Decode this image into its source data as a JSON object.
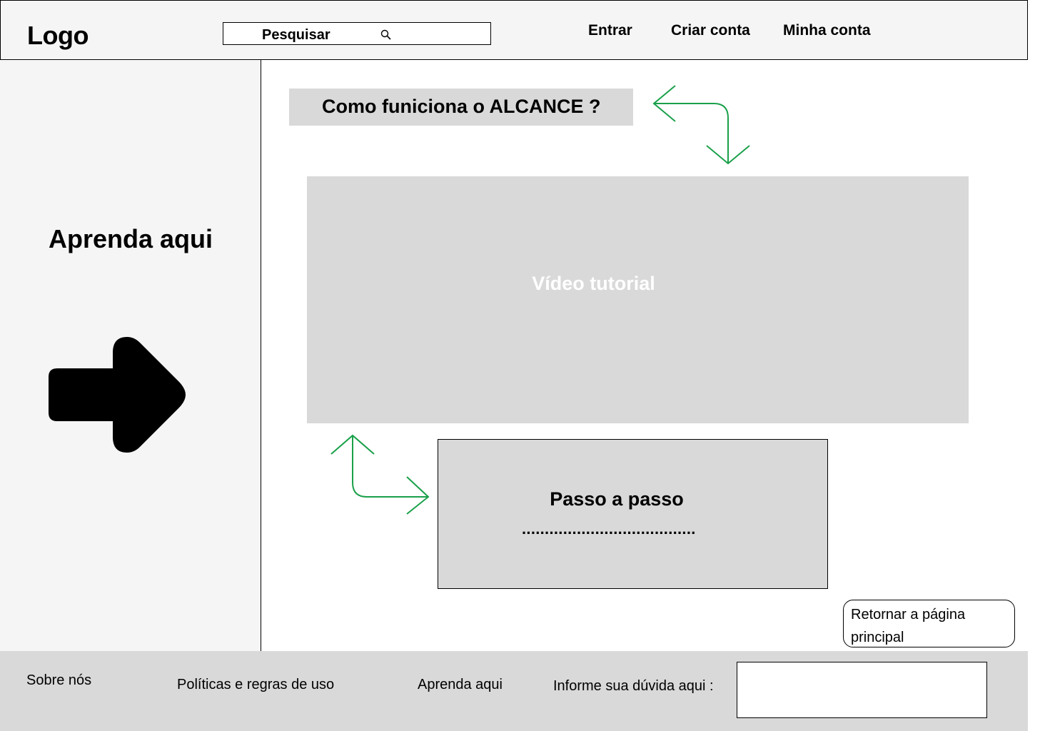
{
  "header": {
    "logo": "Logo",
    "search": {
      "value": "Pesquisar",
      "icon": "search-icon"
    },
    "nav": [
      {
        "label": "Entrar"
      },
      {
        "label": "Criar conta"
      },
      {
        "label": "Minha conta"
      }
    ]
  },
  "sidebar": {
    "title": "Aprenda aqui",
    "icon": "right-arrow-icon"
  },
  "main": {
    "section_title": "Como funiciona o ALCANCE ?",
    "video_label": "Vídeo tutorial",
    "steps": {
      "title": "Passo a passo",
      "dots": "......................................"
    },
    "return_button": "Retornar a página principal"
  },
  "footer": {
    "links": [
      {
        "label": "Sobre nós"
      },
      {
        "label": "Políticas e regras de uso"
      },
      {
        "label": "Aprenda aqui"
      }
    ],
    "question_label": "Informe sua dúvida aqui :",
    "question_input": ""
  },
  "colors": {
    "header_bg": "#f5f5f5",
    "panel_gray": "#d9d9d9",
    "flow_arrow": "#1aa04a"
  }
}
